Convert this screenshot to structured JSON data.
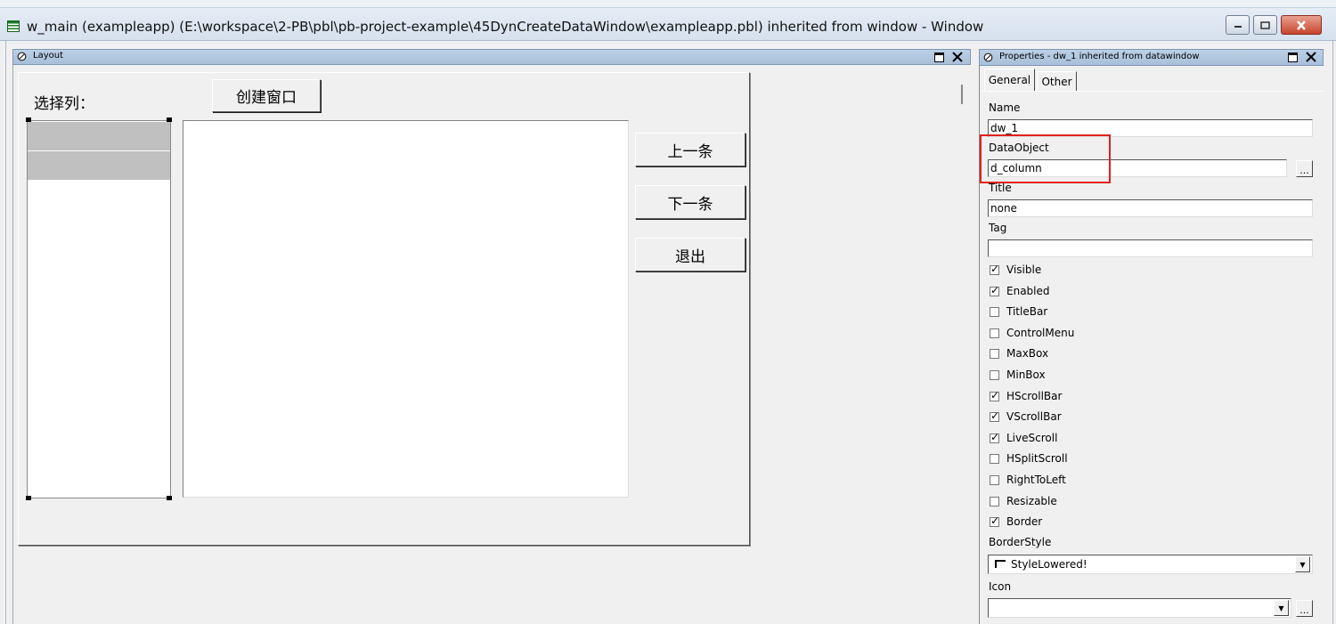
{
  "window": {
    "title": "w_main (exampleapp) (E:\\workspace\\2-PB\\pbl\\pb-project-example\\45DynCreateDataWindow\\exampleapp.pbl) inherited from window - Window"
  },
  "layout_pane": {
    "title": "Layout",
    "label_select": "选择列：",
    "buttons": {
      "create": "创建窗口",
      "prev": "上一条",
      "next": "下一条",
      "exit": "退出"
    }
  },
  "properties_pane": {
    "title": "Properties - dw_1 inherited from datawindow",
    "tabs": [
      "General",
      "Other"
    ],
    "fields": {
      "name_label": "Name",
      "name_value": "dw_1",
      "dataobject_label": "DataObject",
      "dataobject_value": "d_column",
      "title_label": "Title",
      "title_value": "none",
      "tag_label": "Tag",
      "tag_value": "",
      "borderstyle_label": "BorderStyle",
      "borderstyle_value": "StyleLowered!",
      "icon_label": "Icon",
      "icon_value": ""
    },
    "checkboxes": [
      {
        "label": "Visible",
        "checked": true
      },
      {
        "label": "Enabled",
        "checked": true
      },
      {
        "label": "TitleBar",
        "checked": false
      },
      {
        "label": "ControlMenu",
        "checked": false
      },
      {
        "label": "MaxBox",
        "checked": false
      },
      {
        "label": "MinBox",
        "checked": false
      },
      {
        "label": "HScrollBar",
        "checked": true
      },
      {
        "label": "VScrollBar",
        "checked": true
      },
      {
        "label": "LiveScroll",
        "checked": true
      },
      {
        "label": "HSplitScroll",
        "checked": false
      },
      {
        "label": "RightToLeft",
        "checked": false
      },
      {
        "label": "Resizable",
        "checked": false
      },
      {
        "label": "Border",
        "checked": true
      }
    ],
    "ellipsis": "..."
  },
  "colors": {
    "highlight_box": "#e0201c",
    "pane_header": "#a9c0da"
  }
}
